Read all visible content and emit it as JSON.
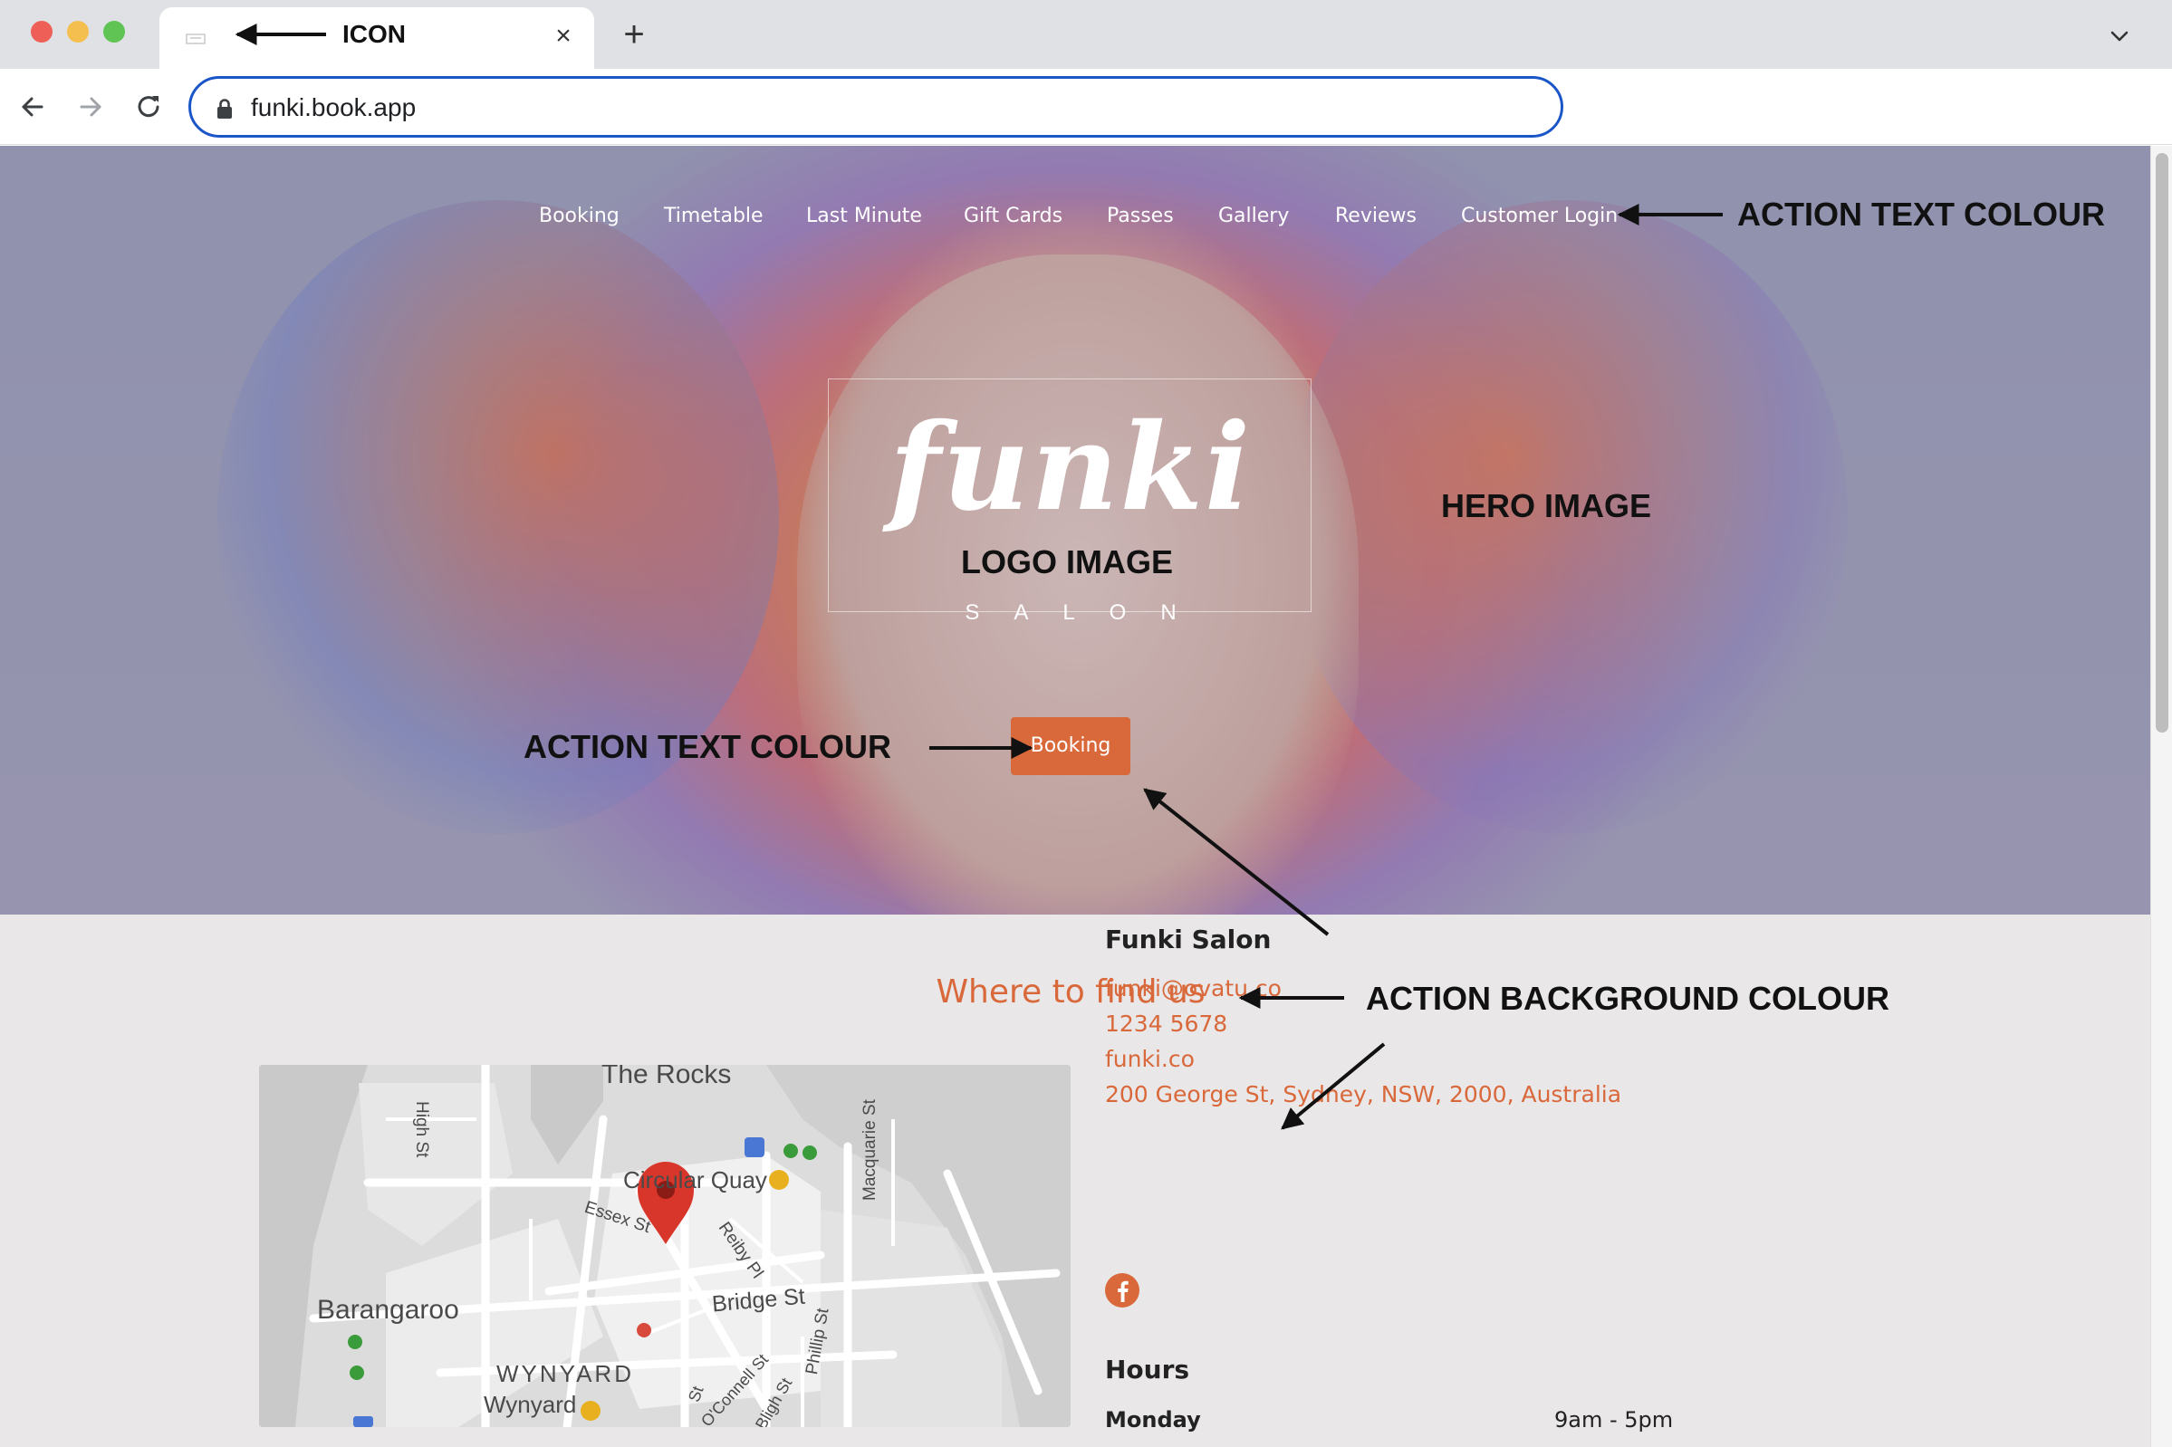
{
  "browser": {
    "tab_close_glyph": "×",
    "new_tab_glyph": "+",
    "url": "funki.book.app"
  },
  "nav": {
    "links": [
      "Booking",
      "Timetable",
      "Last Minute",
      "Gift Cards",
      "Passes",
      "Gallery",
      "Reviews",
      "Customer Login"
    ]
  },
  "hero": {
    "logo_script": "funki",
    "logo_sub": "SALON",
    "cta_label": "Booking"
  },
  "find_us": {
    "title": "Where to find us",
    "map_labels": {
      "the_rocks": "The Rocks",
      "high_st": "High St",
      "circular_quay": "Circular Quay",
      "macquarie_st": "Macquarie St",
      "essex_st": "Essex St",
      "reiby_pl": "Reiby Pl",
      "barangaroo": "Barangaroo",
      "bridge_st": "Bridge St",
      "phillip_st": "Phillip St",
      "wynyard_upper": "WYNYARD",
      "wynyard": "Wynyard",
      "oconnell_st": "O'Connell St",
      "bligh_st": "Bligh St",
      "st": "St"
    },
    "business_name": "Funki Salon",
    "email": "funki@ovatu.co",
    "phone": "1234 5678",
    "website": "funki.co",
    "address": "200 George St, Sydney, NSW, 2000, Australia",
    "hours_title": "Hours",
    "hours": [
      {
        "day": "Monday",
        "time": "9am - 5pm"
      }
    ]
  },
  "annotations": {
    "icon": "ICON",
    "action_text_colour_top": "ACTION TEXT COLOUR",
    "hero_image": "HERO IMAGE",
    "logo_image": "LOGO IMAGE",
    "action_text_colour_btn": "ACTION TEXT COLOUR",
    "action_background_colour": "ACTION BACKGROUND COLOUR"
  },
  "colors": {
    "action_background": "#d9683a",
    "action_text": "#ffffff",
    "page_background": "#e9e7e8",
    "omnibox_border": "#1a56c8"
  },
  "icons": [
    "favicon-icon",
    "close-icon",
    "plus-icon",
    "chevron-down-icon",
    "back-arrow-icon",
    "forward-arrow-icon",
    "reload-icon",
    "lock-icon",
    "map-pin-icon",
    "facebook-icon"
  ]
}
